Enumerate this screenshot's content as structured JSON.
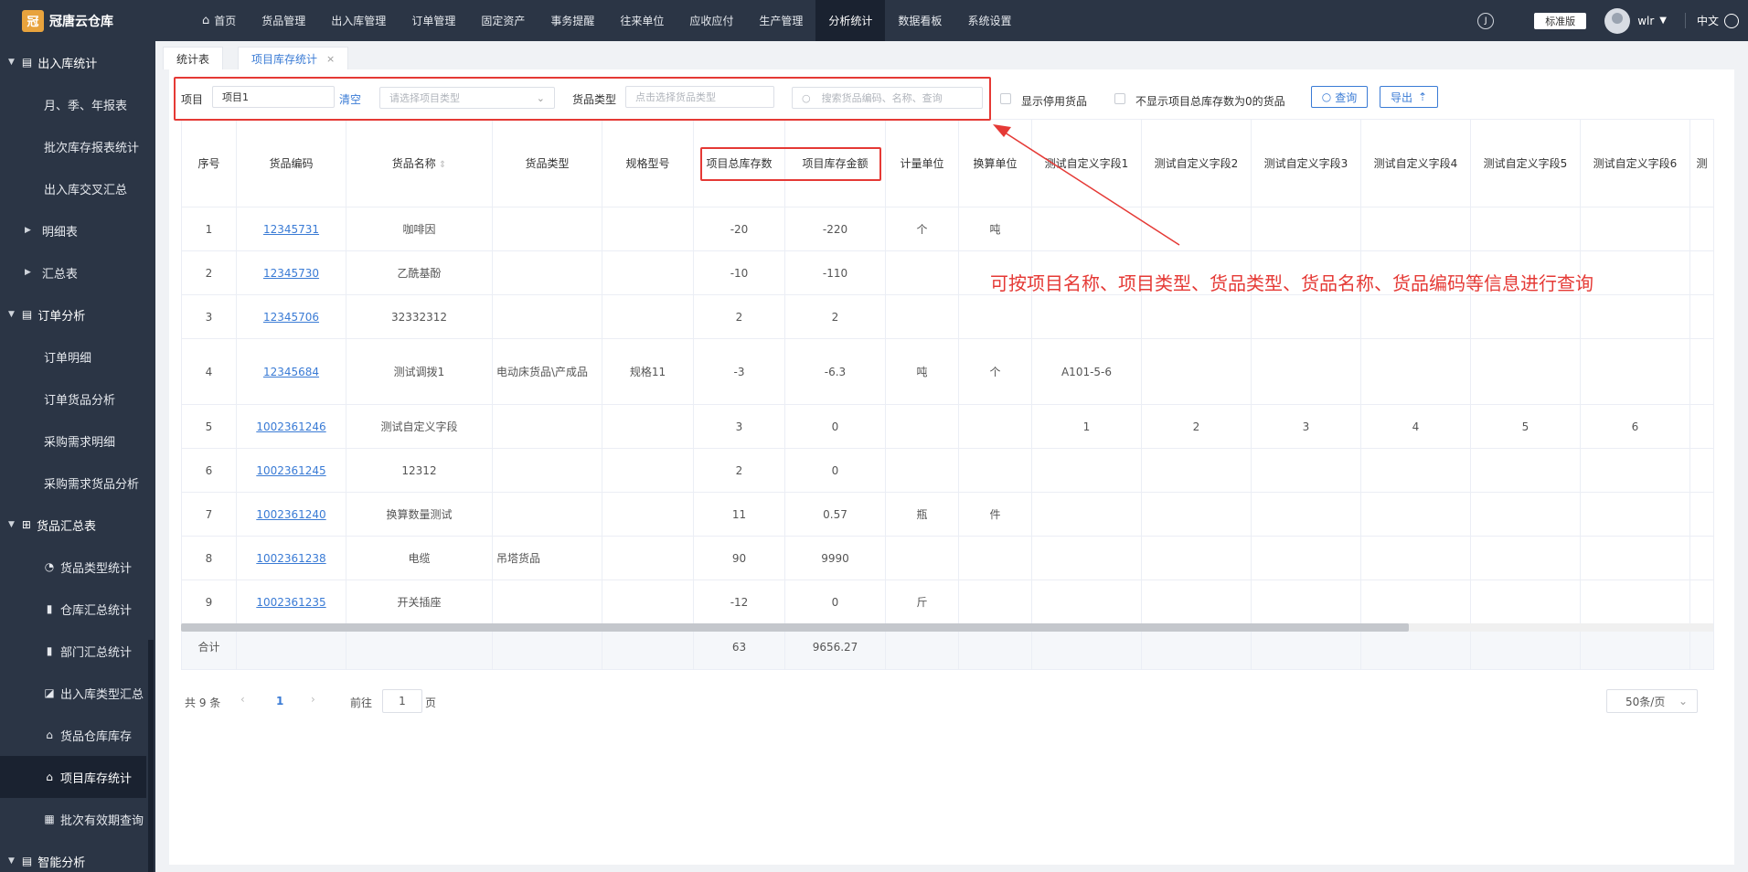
{
  "app": {
    "logo_text": "冠唐云仓库",
    "logo_mark": "冠"
  },
  "nav": [
    "首页",
    "货品管理",
    "出入库管理",
    "订单管理",
    "固定资产",
    "事务提醒",
    "往来单位",
    "应收应付",
    "生产管理",
    "分析统计",
    "数据看板",
    "系统设置"
  ],
  "nav_active": "分析统计",
  "topright": {
    "edition": "标准版",
    "user": "wlr",
    "language": "中文",
    "help_icon": "circle-icon"
  },
  "sidebar": {
    "group1": "出入库统计",
    "g1_items": [
      "月、季、年报表",
      "批次库存报表统计",
      "出入库交叉汇总"
    ],
    "expand1": "明细表",
    "expand2": "汇总表",
    "group2": "订单分析",
    "g2_items": [
      "订单明细",
      "订单货品分析",
      "采购需求明细",
      "采购需求货品分析"
    ],
    "group3": "货品汇总表",
    "g3_items": [
      "货品类型统计",
      "仓库汇总统计",
      "部门汇总统计",
      "出入库类型汇总",
      "货品仓库库存",
      "项目库存统计",
      "批次有效期查询"
    ],
    "group4": "智能分析"
  },
  "tabs": {
    "tab1": "统计表",
    "tab2": "项目库存统计",
    "close": "×"
  },
  "filters": {
    "project_label": "项目",
    "project_value": "项目1",
    "clear": "清空",
    "project_type_placeholder": "请选择项目类型",
    "goods_type_label": "货品类型",
    "goods_type_placeholder": "点击选择货品类型",
    "search_placeholder": "搜索货品编码、名称、查询",
    "chk1": "显示停用货品",
    "chk2": "不显示项目总库存数为0的货品",
    "query": "查询",
    "export": "导出"
  },
  "table": {
    "headers": [
      "序号",
      "货品编码",
      "货品名称",
      "货品类型",
      "规格型号",
      "项目总库存数",
      "项目库存金额",
      "计量单位",
      "换算单位",
      "测试自定义字段1",
      "测试自定义字段2",
      "测试自定义字段3",
      "测试自定义字段4",
      "测试自定义字段5",
      "测试自定义字段6",
      "测"
    ],
    "rows": [
      [
        "1",
        "12345731",
        "咖啡因",
        "",
        "",
        "-20",
        "-220",
        "个",
        "吨",
        "",
        "",
        "",
        "",
        "",
        ""
      ],
      [
        "2",
        "12345730",
        "乙酰基酚",
        "",
        "",
        "-10",
        "-110",
        "",
        "",
        "",
        "",
        "",
        "",
        "",
        ""
      ],
      [
        "3",
        "12345706",
        "32332312",
        "",
        "",
        "2",
        "2",
        "",
        "",
        "",
        "",
        "",
        "",
        "",
        ""
      ],
      [
        "4",
        "12345684",
        "测试调拨1",
        "电动床货品\\产成品",
        "规格11",
        "-3",
        "-6.3",
        "吨",
        "个",
        "A101-5-6",
        "",
        "",
        "",
        "",
        ""
      ],
      [
        "5",
        "1002361246",
        "测试自定义字段",
        "",
        "",
        "3",
        "0",
        "",
        "",
        "1",
        "2",
        "3",
        "4",
        "5",
        "6"
      ],
      [
        "6",
        "1002361245",
        "12312",
        "",
        "",
        "2",
        "0",
        "",
        "",
        "",
        "",
        "",
        "",
        "",
        ""
      ],
      [
        "7",
        "1002361240",
        "换算数量测试",
        "",
        "",
        "11",
        "0.57",
        "瓶",
        "件",
        "",
        "",
        "",
        "",
        "",
        ""
      ],
      [
        "8",
        "1002361238",
        "电缆",
        "吊塔货品",
        "",
        "90",
        "9990",
        "",
        "",
        "",
        "",
        "",
        "",
        "",
        ""
      ],
      [
        "9",
        "1002361235",
        "开关插座",
        "",
        "",
        "-12",
        "0",
        "斤",
        "",
        "",
        "",
        "",
        "",
        "",
        ""
      ]
    ],
    "sum_label": "合计",
    "sum_qty": "63",
    "sum_amount": "9656.27"
  },
  "pagination": {
    "total": "共 9 条",
    "page": "1",
    "goto": "前往",
    "goto_value": "1",
    "page_unit": "页",
    "page_size": "50条/页"
  },
  "annotation": "可按项目名称、项目类型、货品类型、货品名称、货品编码等信息进行查询",
  "colors": {
    "accent": "#3a7bd5",
    "sidebar": "#2b3545",
    "annotation": "#e53935"
  }
}
